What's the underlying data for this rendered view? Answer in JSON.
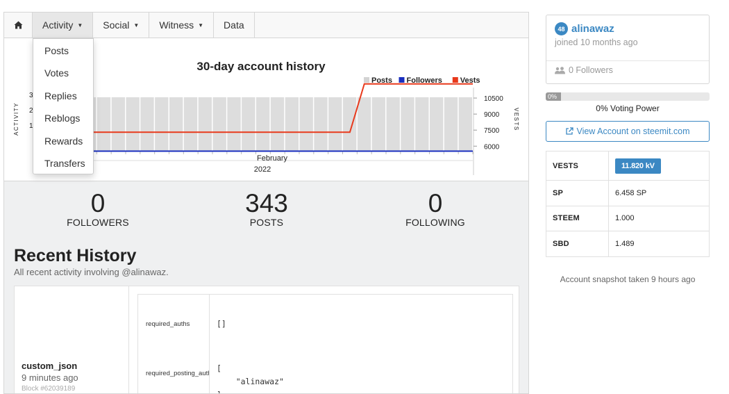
{
  "nav": {
    "items": [
      {
        "label": "Activity",
        "has_caret": true,
        "active": true
      },
      {
        "label": "Social",
        "has_caret": true,
        "active": false
      },
      {
        "label": "Witness",
        "has_caret": true,
        "active": false
      },
      {
        "label": "Data",
        "has_caret": false,
        "active": false
      }
    ],
    "home_icon": "home-icon"
  },
  "dropdown": {
    "items": [
      "Posts",
      "Votes",
      "Replies",
      "Reblogs",
      "Rewards",
      "Transfers"
    ]
  },
  "chart_data": {
    "type": "line",
    "title": "30-day account history",
    "legend": [
      {
        "name": "Posts",
        "color": "#d3d3d3"
      },
      {
        "name": "Followers",
        "color": "#1a2fbf"
      },
      {
        "name": "Vests",
        "color": "#e8391c"
      }
    ],
    "legend_position": "top-right",
    "left_axis_label": "ACTIVITY",
    "right_axis_label": "VESTS",
    "left_ticks_visible": [
      "3",
      "2",
      "1"
    ],
    "right_ticks": [
      "10500",
      "9000",
      "7500",
      "6000"
    ],
    "right_ylim": [
      5500,
      12000
    ],
    "x_month_label": "February",
    "x_year_label": "2022",
    "days": 30,
    "posts_bar_color": "#dddddd",
    "series": [
      {
        "name": "Vests",
        "color": "#e8391c",
        "values": [
          7300,
          7300,
          7300,
          7300,
          7300,
          7300,
          7300,
          7300,
          7300,
          7300,
          7300,
          7300,
          7300,
          7300,
          7300,
          7300,
          7300,
          7300,
          7300,
          7300,
          7300,
          7300,
          11820,
          11820,
          11820,
          11820,
          11820,
          11820,
          11820,
          11820
        ]
      },
      {
        "name": "Followers",
        "color": "#1a2fbf",
        "values": [
          0,
          0,
          0,
          0,
          0,
          0,
          0,
          0,
          0,
          0,
          0,
          0,
          0,
          0,
          0,
          0,
          0,
          0,
          0,
          0,
          0,
          0,
          0,
          0,
          0,
          0,
          0,
          0,
          0,
          0
        ]
      }
    ],
    "grid": true
  },
  "stats": {
    "followers": {
      "value": "0",
      "label": "FOLLOWERS"
    },
    "posts": {
      "value": "343",
      "label": "POSTS"
    },
    "following": {
      "value": "0",
      "label": "FOLLOWING"
    }
  },
  "recent": {
    "title": "Recent History",
    "subtitle": "All recent activity involving @alinawaz."
  },
  "history_item": {
    "op": "custom_json",
    "time": "9 minutes ago",
    "block": "Block #62039189",
    "fields": [
      {
        "key": "required_auths",
        "value": "[]"
      },
      {
        "key": "required_posting_auths",
        "value": "[\n    \"alinawaz\"\n]"
      }
    ]
  },
  "profile": {
    "reputation": "48",
    "username": "alinawaz",
    "joined": "joined 10 months ago",
    "followers": "0 Followers"
  },
  "voting": {
    "percent_label": "0%",
    "fraction": 0,
    "text": "0% Voting Power"
  },
  "view_account": {
    "label": "View Account on steemit.com"
  },
  "balances": {
    "vests_key": "VESTS",
    "vests_value": "11.820 kV",
    "sp_key": "SP",
    "sp_value": "6.458 SP",
    "steem_key": "STEEM",
    "steem_value": "1.000",
    "sbd_key": "SBD",
    "sbd_value": "1.489"
  },
  "snapshot": "Account snapshot taken 9 hours ago"
}
